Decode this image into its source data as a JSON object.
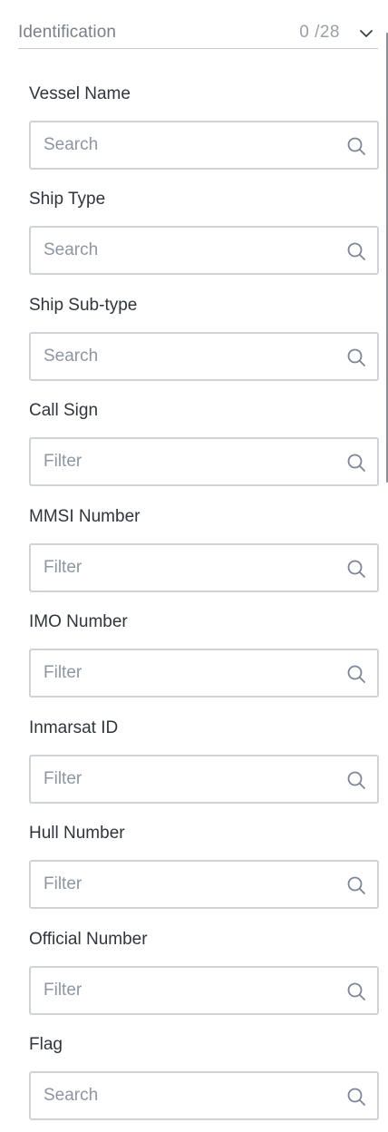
{
  "section": {
    "title": "Identification",
    "count": "0 /28"
  },
  "fields": [
    {
      "label": "Vessel Name",
      "placeholder": "Search",
      "value": ""
    },
    {
      "label": "Ship Type",
      "placeholder": "Search",
      "value": ""
    },
    {
      "label": "Ship Sub-type",
      "placeholder": "Search",
      "value": ""
    },
    {
      "label": "Call Sign",
      "placeholder": "Filter",
      "value": ""
    },
    {
      "label": "MMSI Number",
      "placeholder": "Filter",
      "value": ""
    },
    {
      "label": "IMO Number",
      "placeholder": "Filter",
      "value": ""
    },
    {
      "label": "Inmarsat ID",
      "placeholder": "Filter",
      "value": ""
    },
    {
      "label": "Hull Number",
      "placeholder": "Filter",
      "value": ""
    },
    {
      "label": "Official Number",
      "placeholder": "Filter",
      "value": ""
    },
    {
      "label": "Flag",
      "placeholder": "Search",
      "value": ""
    }
  ],
  "icons": {
    "collapse": "chevron-down-icon",
    "search": "search-icon"
  },
  "colors": {
    "border": "#cfd3d8",
    "placeholder": "#8e95a3",
    "label": "#30353d",
    "icon": "#7d8696"
  }
}
